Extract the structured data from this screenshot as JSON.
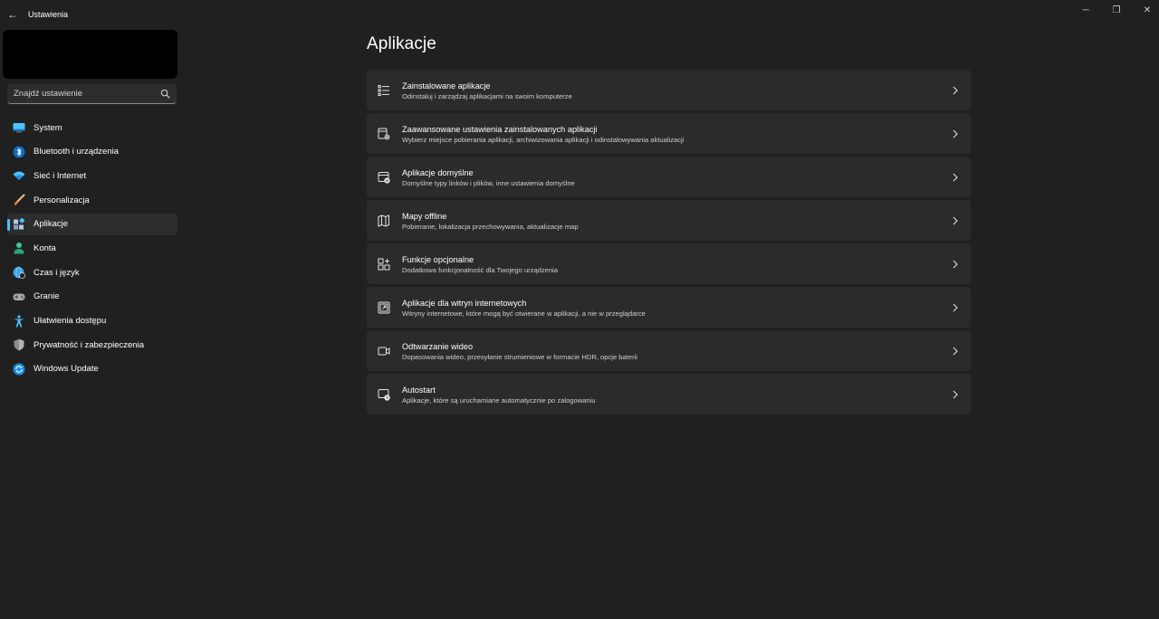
{
  "window": {
    "title": "Ustawienia",
    "back_glyph": "←",
    "minimize_glyph": "─",
    "maximize_glyph": "❐",
    "close_glyph": "✕"
  },
  "search": {
    "placeholder": "Znajdź ustawienie",
    "value": ""
  },
  "sidebar": {
    "items": [
      {
        "label": "System",
        "icon": "display-icon",
        "color": "#4cc2ff"
      },
      {
        "label": "Bluetooth i urządzenia",
        "icon": "bluetooth-icon",
        "color": "#0078d4"
      },
      {
        "label": "Sieć i Internet",
        "icon": "wifi-icon",
        "color": "#4cc2ff"
      },
      {
        "label": "Personalizacja",
        "icon": "brush-icon",
        "color": "#e8a87c"
      },
      {
        "label": "Aplikacje",
        "icon": "apps-icon",
        "color": "#9ab0c8",
        "active": true
      },
      {
        "label": "Konta",
        "icon": "person-icon",
        "color": "#3ec79b"
      },
      {
        "label": "Czas i język",
        "icon": "globe-clock-icon",
        "color": "#4cc2ff"
      },
      {
        "label": "Granie",
        "icon": "gamepad-icon",
        "color": "#b0b0b0"
      },
      {
        "label": "Ułatwienia dostępu",
        "icon": "accessibility-icon",
        "color": "#4cc2ff"
      },
      {
        "label": "Prywatność i zabezpieczenia",
        "icon": "shield-icon",
        "color": "#9a9a9a"
      },
      {
        "label": "Windows Update",
        "icon": "update-icon",
        "color": "#1a8fe0"
      }
    ]
  },
  "main": {
    "title": "Aplikacje",
    "cards": [
      {
        "title": "Zainstalowane aplikacje",
        "subtitle": "Odinstaluj i zarządzaj aplikacjami na swoim komputerze",
        "icon": "list-icon"
      },
      {
        "title": "Zaawansowane ustawienia zainstalowanych aplikacji",
        "subtitle": "Wybierz miejsce pobierania aplikacji, archiwizowania aplikacji i odinstalowywania aktualizacji",
        "icon": "app-settings-icon"
      },
      {
        "title": "Aplikacje domyślne",
        "subtitle": "Domyślne typy linków i plików, inne ustawienia domyślne",
        "icon": "default-apps-icon"
      },
      {
        "title": "Mapy offline",
        "subtitle": "Pobieranie, lokalizacja przechowywania, aktualizacje map",
        "icon": "map-icon"
      },
      {
        "title": "Funkcje opcjonalne",
        "subtitle": "Dodatkowa funkcjonalność dla Twojego urządzenia",
        "icon": "add-grid-icon"
      },
      {
        "title": "Aplikacje dla witryn internetowych",
        "subtitle": "Witryny internetowe, które mogą być otwierane w aplikacji, a nie w przeglądarce",
        "icon": "open-external-icon"
      },
      {
        "title": "Odtwarzanie wideo",
        "subtitle": "Dopasowania wideo, przesyłanie strumieniowe w formacie HDR, opcje baterii",
        "icon": "video-icon"
      },
      {
        "title": "Autostart",
        "subtitle": "Aplikacje, które są uruchamiane automatycznie po zalogowaniu",
        "icon": "startup-icon"
      }
    ]
  },
  "colors": {
    "background": "#202020",
    "card": "#2b2b2b",
    "accent": "#4cc2ff"
  }
}
